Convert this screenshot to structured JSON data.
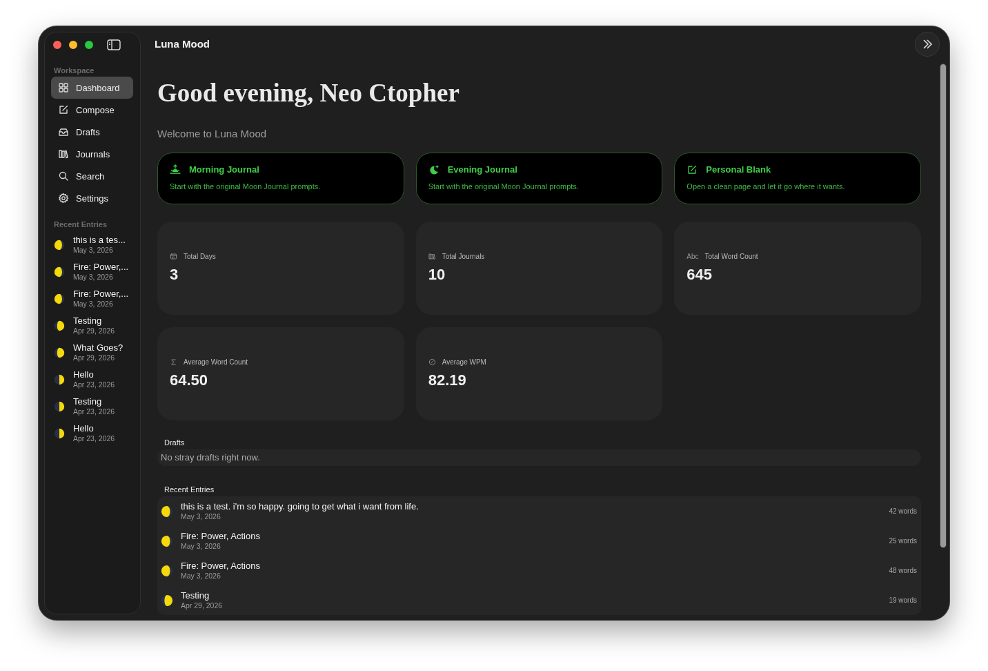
{
  "window": {
    "title": "Luna Mood"
  },
  "sidebar": {
    "workspace_heading": "Workspace",
    "items": [
      {
        "label": "Dashboard",
        "kind": "grid",
        "selected": true
      },
      {
        "label": "Compose",
        "kind": "compose",
        "selected": false
      },
      {
        "label": "Drafts",
        "kind": "tray",
        "selected": false
      },
      {
        "label": "Journals",
        "kind": "books",
        "selected": false
      },
      {
        "label": "Search",
        "kind": "search",
        "selected": false
      },
      {
        "label": "Settings",
        "kind": "gear",
        "selected": false
      }
    ],
    "recent_heading": "Recent Entries",
    "recent": [
      {
        "title": "this is a tes...",
        "date": "May 3, 2026",
        "kind": "waning"
      },
      {
        "title": "Fire: Power,...",
        "date": "May 3, 2026",
        "kind": "waning"
      },
      {
        "title": "Fire: Power,...",
        "date": "May 3, 2026",
        "kind": "waning"
      },
      {
        "title": "Testing",
        "date": "Apr 29, 2026",
        "kind": "gibbous"
      },
      {
        "title": "What Goes?",
        "date": "Apr 29, 2026",
        "kind": "gibbous"
      },
      {
        "title": "Hello",
        "date": "Apr 23, 2026",
        "kind": "quarter"
      },
      {
        "title": "Testing",
        "date": "Apr 23, 2026",
        "kind": "quarter"
      },
      {
        "title": "Hello",
        "date": "Apr 23, 2026",
        "kind": "quarter"
      }
    ]
  },
  "greeting": "Good evening, Neo Ctopher",
  "subtitle": "Welcome to Luna Mood",
  "launch_cards": [
    {
      "title": "Morning Journal",
      "description": "Start with the original Moon Journal prompts.",
      "kind": "sunrise"
    },
    {
      "title": "Evening Journal",
      "description": "Start with the original Moon Journal prompts.",
      "kind": "moon"
    },
    {
      "title": "Personal Blank",
      "description": "Open a clean page and let it go where it wants.",
      "kind": "compose"
    }
  ],
  "stats": [
    {
      "label": "Total Days",
      "value": "3",
      "kind": "calendar"
    },
    {
      "label": "Total Journals",
      "value": "10",
      "kind": "books"
    },
    {
      "label": "Total Word Count",
      "value": "645",
      "kind": "text",
      "icon_text": "Abc"
    },
    {
      "label": "Average Word Count",
      "value": "64.50",
      "kind": "sigma"
    },
    {
      "label": "Average WPM",
      "value": "82.19",
      "kind": "gauge"
    }
  ],
  "drafts": {
    "heading": "Drafts",
    "empty_message": "No stray drafts right now."
  },
  "recent_entries": {
    "heading": "Recent Entries",
    "rows": [
      {
        "title": "this is a test. i'm so happy. going to get what i want from life.",
        "date": "May 3, 2026",
        "words": "42 words",
        "kind": "waning"
      },
      {
        "title": "Fire: Power, Actions",
        "date": "May 3, 2026",
        "words": "25 words",
        "kind": "waning"
      },
      {
        "title": "Fire: Power, Actions",
        "date": "May 3, 2026",
        "words": "48 words",
        "kind": "waning"
      },
      {
        "title": "Testing",
        "date": "Apr 29, 2026",
        "words": "19 words",
        "kind": "gibbous"
      }
    ]
  }
}
